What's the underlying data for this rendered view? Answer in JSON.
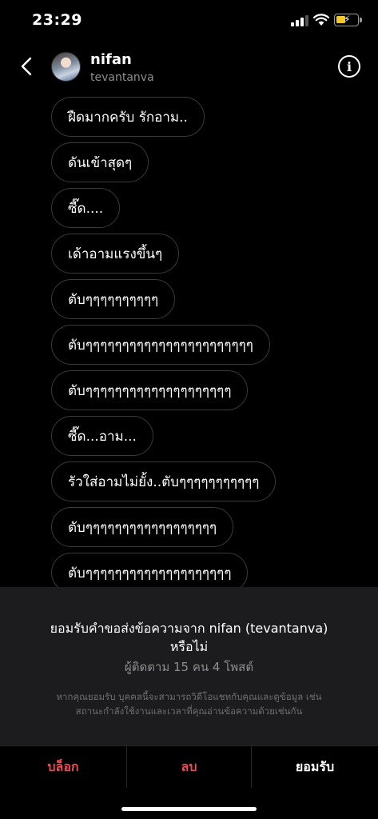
{
  "status_bar": {
    "time": "23:29"
  },
  "header": {
    "name": "nifan",
    "username": "tevantanva"
  },
  "messages": [
    "ฝืดมากครับ  รักอาม..",
    "ดันเข้าสุดๆ",
    "ซี๊ด....",
    "เด้าอามแรงขึ้นๆ",
    "ตับๆๆๆๆๆๆๆๆๆๆ",
    "ตับๆๆๆๆๆๆๆๆๆๆๆๆๆๆๆๆๆๆๆๆๆๆๆ",
    "ตับๆๆๆๆๆๆๆๆๆๆๆๆๆๆๆๆๆๆๆๆ",
    "ซี๊ด...อาม...",
    "รัวใส่อามไม่ยั้ง..ตับๆๆๆๆๆๆๆๆๆๆๆ",
    "ตับๆๆๆๆๆๆๆๆๆๆๆๆๆๆๆๆๆๆ",
    "ตับๆๆๆๆๆๆๆๆๆๆๆๆๆๆๆๆๆๆๆๆ"
  ],
  "request": {
    "title_line1": "ยอมรับคำขอส่งข้อความจาก nifan (tevantanva)",
    "title_line2": "หรือไม่",
    "subtitle": "ผู้ติดตาม 15 คน 4 โพสต์",
    "note_line1": "หากคุณยอมรับ บุคคลนี้จะสามารถวิดีโอแชทกับคุณและดูข้อมูล เช่น",
    "note_line2": "สถานะกำลังใช้งานและเวลาที่คุณอ่านข้อความด้วยเช่นกัน"
  },
  "actions": {
    "block": "บล็อก",
    "delete": "ลบ",
    "accept": "ยอมรับ"
  }
}
